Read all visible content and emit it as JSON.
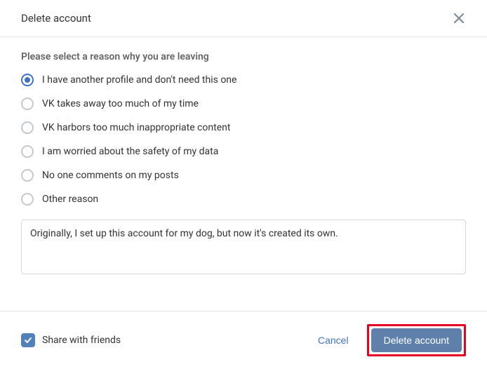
{
  "header": {
    "title": "Delete account"
  },
  "prompt": "Please select a reason why you are leaving",
  "options": [
    {
      "label": "I have another profile and don't need this one",
      "selected": true
    },
    {
      "label": "VK takes away too much of my time",
      "selected": false
    },
    {
      "label": "VK harbors too much inappropriate content",
      "selected": false
    },
    {
      "label": "I am worried about the safety of my data",
      "selected": false
    },
    {
      "label": "No one comments on my posts",
      "selected": false
    },
    {
      "label": "Other reason",
      "selected": false
    }
  ],
  "reason_text": "Originally, I set up this account for my dog, but now it's created its own.",
  "share": {
    "label": "Share with friends",
    "checked": true
  },
  "actions": {
    "cancel": "Cancel",
    "delete": "Delete account"
  }
}
